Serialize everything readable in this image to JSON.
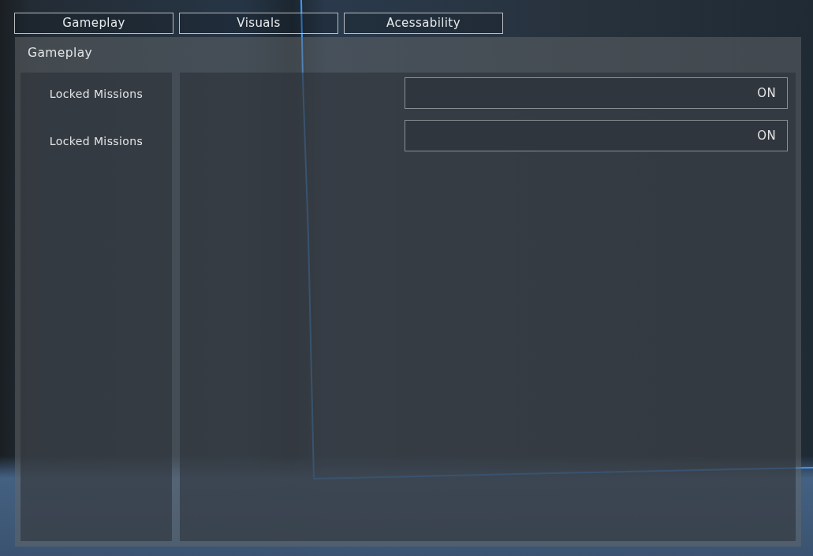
{
  "tabs": [
    {
      "label": "Gameplay"
    },
    {
      "label": "Visuals"
    },
    {
      "label": "Acessability"
    }
  ],
  "panel": {
    "title": "Gameplay",
    "settings": [
      {
        "label": "Locked Missions",
        "value": "ON"
      },
      {
        "label": "Locked Missions",
        "value": "ON"
      }
    ]
  }
}
